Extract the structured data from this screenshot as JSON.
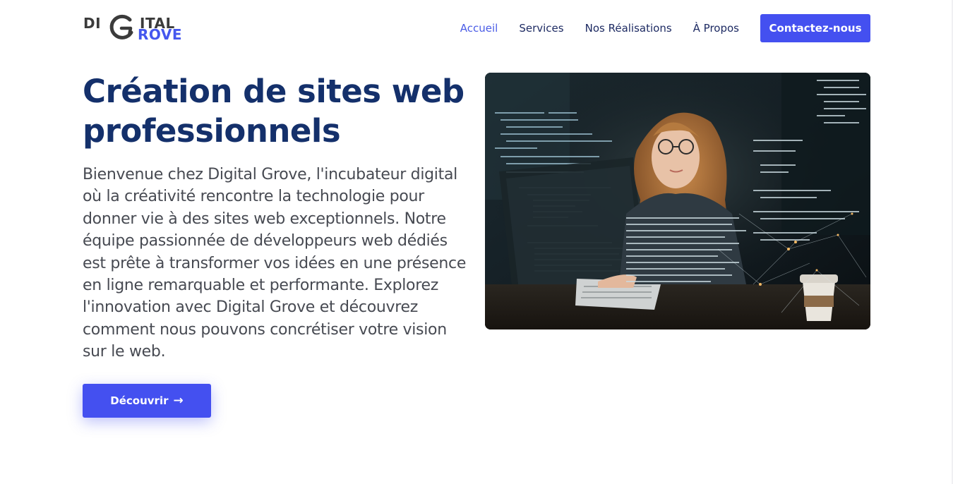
{
  "brand": {
    "logo_top_left": "DI",
    "logo_top_right": "ITAL",
    "logo_bottom": "ROVE",
    "primary_color": "#4450f0",
    "heading_color": "#14306b"
  },
  "nav": {
    "items": [
      {
        "label": "Accueil",
        "active": true
      },
      {
        "label": "Services",
        "active": false
      },
      {
        "label": "Nos Réalisations",
        "active": false
      },
      {
        "label": "À Propos",
        "active": false
      }
    ],
    "cta_label": "Contactez-nous"
  },
  "hero": {
    "title": "Création de sites web professionnels",
    "description": "Bienvenue chez Digital Grove, l'incubateur digital où la créativité rencontre la technologie pour donner vie à des sites web exceptionnels. Notre équipe passionnée de développeurs web dédiés est prête à transformer vos idées en une présence en ligne remarquable et performante. Explorez l'innovation avec Digital Grove et découvrez comment nous pouvons concrétiser votre vision sur le web.",
    "button_label": "Découvrir",
    "button_icon": "arrow-right-icon",
    "image_icon": "developer-at-computer-photo"
  }
}
